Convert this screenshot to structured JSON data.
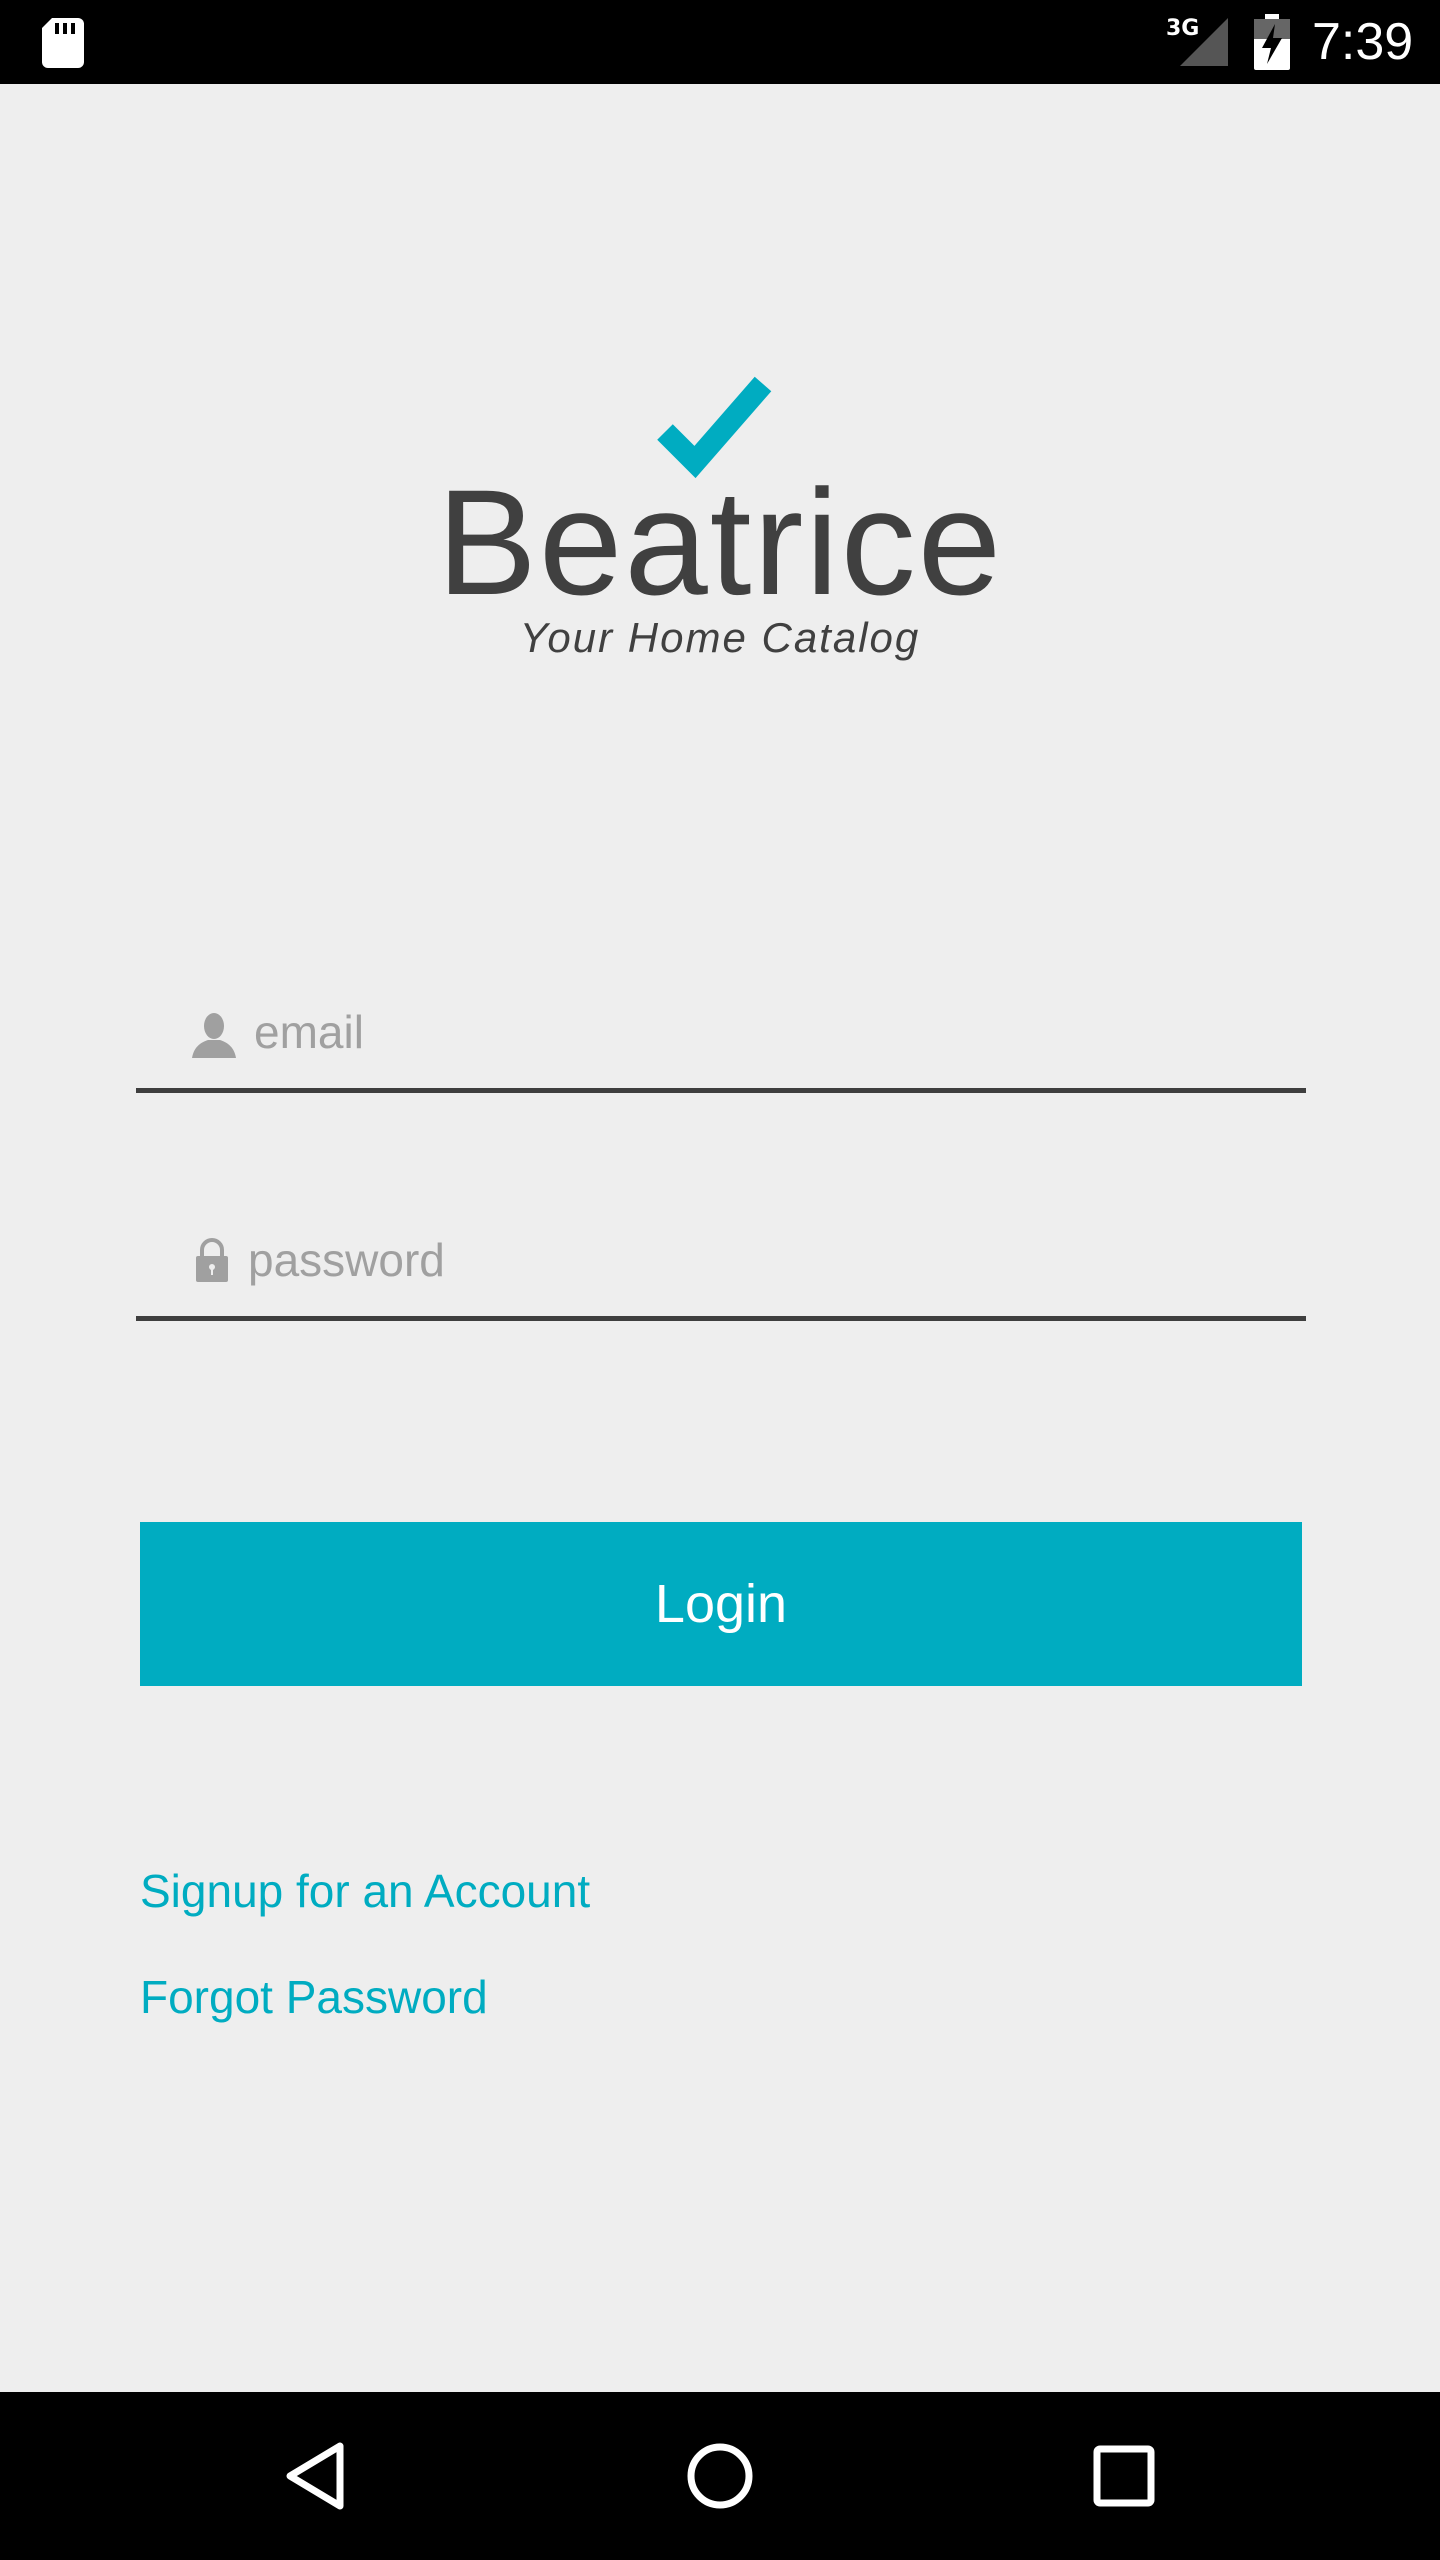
{
  "status_bar": {
    "network": "3G",
    "time": "7:39",
    "icons": [
      "sd-card-icon",
      "signal-icon",
      "battery-charging-icon"
    ]
  },
  "logo": {
    "app_name": "Beatrice",
    "tagline": "Your Home Catalog",
    "mark_icon": "checkmark-icon"
  },
  "form": {
    "email": {
      "placeholder": "email",
      "value": "",
      "icon": "person-icon"
    },
    "password": {
      "placeholder": "password",
      "value": "",
      "icon": "lock-icon"
    },
    "login_label": "Login"
  },
  "links": {
    "signup": "Signup for an Account",
    "forgot": "Forgot Password"
  },
  "nav_bar": {
    "icons": [
      "back-icon",
      "home-icon",
      "recents-icon"
    ]
  },
  "colors": {
    "accent": "#00acc1",
    "background": "#eeeeee",
    "text_dark": "#404040",
    "placeholder": "#a0a0a0",
    "bars": "#000000"
  }
}
